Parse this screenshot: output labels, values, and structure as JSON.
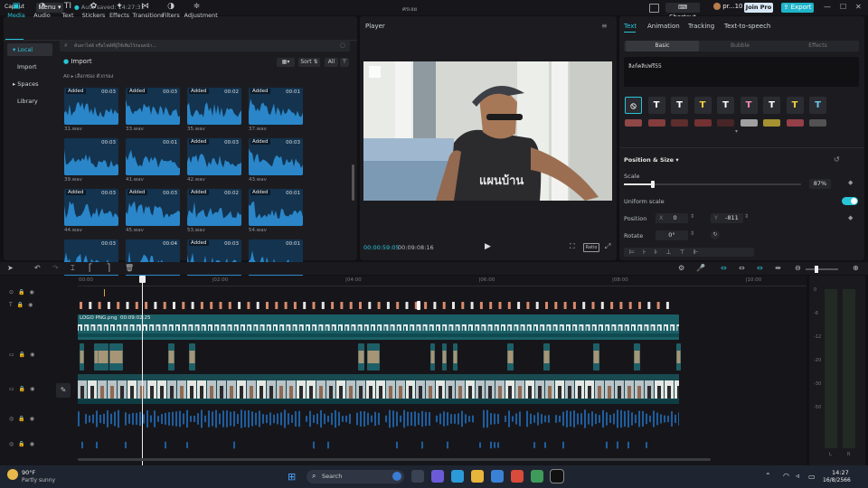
{
  "titlebar": {
    "logo": "CapCut",
    "menu_label": "Menu",
    "menu_arrow": "▾",
    "autosave_text": "Auto saved: 14:27:31",
    "project_name": "ศรเจย",
    "shortcut_label": "Shortcut",
    "user_label": "pr...10",
    "joinpro_label": "Join Pro",
    "export_label": "Export"
  },
  "media": {
    "tools": [
      {
        "label": "Media",
        "icon": "▣"
      },
      {
        "label": "Audio",
        "icon": "◔"
      },
      {
        "label": "Text",
        "icon": "TI"
      },
      {
        "label": "Stickers",
        "icon": "✿"
      },
      {
        "label": "Effects",
        "icon": "✦"
      },
      {
        "label": "Transitions",
        "icon": "⋈"
      },
      {
        "label": "Filters",
        "icon": "◑"
      },
      {
        "label": "Adjustment",
        "icon": "≑"
      }
    ],
    "sidebar": [
      "Local",
      "Import",
      "Spaces",
      "Library"
    ],
    "sidebar_bullets": [
      "▾",
      "",
      "▸",
      ""
    ],
    "search_placeholder": "ค้นหาไฟล์ หรือไฟล์ที่ผู้ใช้เพิ่มไว้ก่อนหน้า...",
    "import_label": "Import",
    "sort_label": "Sort",
    "all_label": "All",
    "filter_all": "All",
    "filter_sep": "▸",
    "filter_text": "เลือกช่อง ตัวกรอง",
    "thumbs": [
      {
        "badge": "Added",
        "dur": "00:03",
        "name": "31.wav"
      },
      {
        "badge": "Added",
        "dur": "00:03",
        "name": "33.wav"
      },
      {
        "badge": "Added",
        "dur": "00:02",
        "name": "35.wav"
      },
      {
        "badge": "Added",
        "dur": "00:01",
        "name": "37.wav"
      },
      {
        "badge": "",
        "dur": "00:03",
        "name": "39.wav"
      },
      {
        "badge": "",
        "dur": "00:01",
        "name": "41.wav"
      },
      {
        "badge": "Added",
        "dur": "00:03",
        "name": "42.wav"
      },
      {
        "badge": "Added",
        "dur": "00:03",
        "name": "43.wav"
      },
      {
        "badge": "Added",
        "dur": "00:03",
        "name": "44.wav"
      },
      {
        "badge": "Added",
        "dur": "00:03",
        "name": "45.wav"
      },
      {
        "badge": "Added",
        "dur": "00:02",
        "name": "53.wav"
      },
      {
        "badge": "Added",
        "dur": "00:01",
        "name": "54.wav"
      },
      {
        "badge": "",
        "dur": "00:03",
        "name": ""
      },
      {
        "badge": "",
        "dur": "00:04",
        "name": ""
      },
      {
        "badge": "Added",
        "dur": "00:03",
        "name": ""
      },
      {
        "badge": "",
        "dur": "00:01",
        "name": ""
      }
    ]
  },
  "player": {
    "title": "Player",
    "current_time": "00:00:59:05",
    "total_time": "00:09:08:16",
    "ratio_label": "Ratio",
    "shirt_text": "แผนบ้าน"
  },
  "props": {
    "tabs": [
      "Text",
      "Animation",
      "Tracking",
      "Text-to-speech"
    ],
    "segments": [
      "Basic",
      "Bubble",
      "Effects"
    ],
    "text_value": "ลิงก์คลิปฟรี55",
    "section_title": "Position & Size",
    "scale_label": "Scale",
    "scale_value": "87%",
    "scale_fraction": 0.87,
    "uniform_scale_label": "Uniform scale",
    "uniform_scale_on": true,
    "position_label": "Position",
    "pos_x_label": "X",
    "pos_x": "0",
    "pos_y_label": "Y",
    "pos_y": "-811",
    "rotate_label": "Rotate",
    "rotate_value": "0°"
  },
  "timeline": {
    "ruler": [
      "00:00",
      "|02:00",
      "|04:00",
      "|06:00",
      "|08:00",
      "|10:00"
    ],
    "logo_clip": "LOGO PNG.png",
    "logo_clip_dur": "00:09:02:25",
    "meter_labels": [
      "0",
      "-6",
      "-12",
      "-20",
      "-30",
      "-50"
    ],
    "meter_lr": [
      "L",
      "R"
    ]
  },
  "taskbar": {
    "temp": "90°F",
    "weather": "Partly sunny",
    "search_placeholder": "Search",
    "time": "14:27",
    "date": "16/8/2566"
  },
  "colors": {
    "accent": "#29c5d9",
    "export_bg": "#1fb4c9",
    "waveform": "#2a86c9",
    "thumb_bg": "#13334f",
    "clip_teal": "#1e6a72",
    "clip_dark": "#174a52"
  }
}
